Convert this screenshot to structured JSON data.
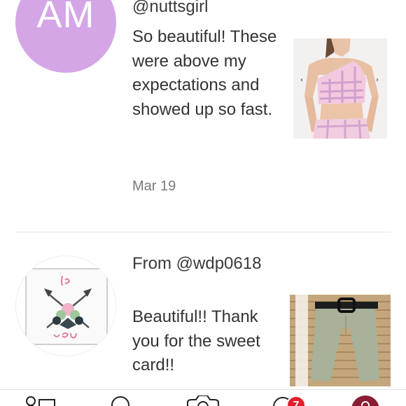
{
  "reviews": [
    {
      "avatar_initials": "AM",
      "author": "@nuttsgirl",
      "text": "So beautiful! These were above my expectations and showed up so fast.",
      "date": "Mar 19"
    },
    {
      "author": "From @wdp0618",
      "text": "Beautiful!! Thank you for the sweet card!!"
    }
  ],
  "tabbar": {
    "items": [
      {
        "icon": "person-icon"
      },
      {
        "icon": "search-icon"
      },
      {
        "icon": "camera-icon"
      },
      {
        "icon": "news-icon",
        "badge": "7"
      },
      {
        "icon": "closet-icon"
      }
    ]
  },
  "colors": {
    "avatar_am": "#d4a6e6",
    "badge": "#e0202a",
    "closet": "#8b1d35"
  }
}
